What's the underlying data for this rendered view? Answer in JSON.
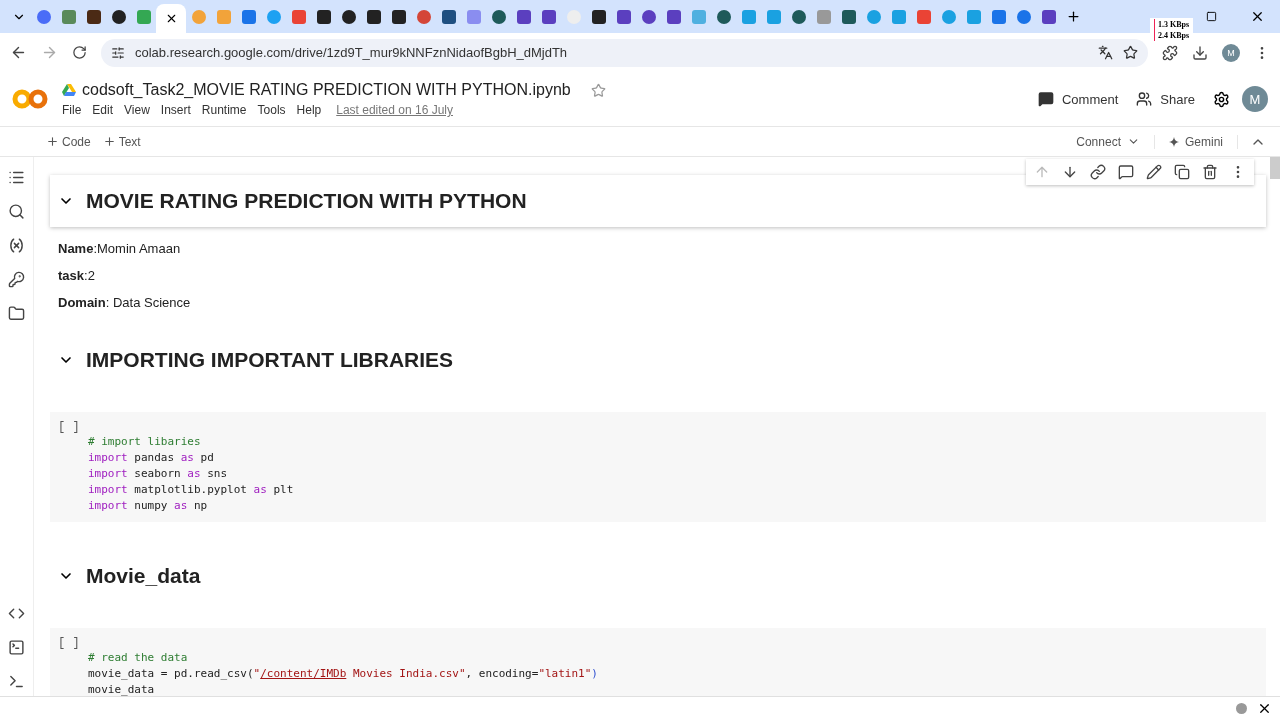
{
  "browser": {
    "url": "colab.research.google.com/drive/1zd9T_mur9kNNFznNidaofBgbH_dMjdTh",
    "net_speed": [
      "1.3 KBps",
      "2.4 KBps"
    ],
    "avatar": "M"
  },
  "notebook": {
    "title": "codsoft_Task2_MOVIE RATING PREDICTION WITH PYTHON.ipynb",
    "menu": [
      "File",
      "Edit",
      "View",
      "Insert",
      "Runtime",
      "Tools",
      "Help"
    ],
    "last_edited": "Last edited on 16 July",
    "comment": "Comment",
    "share": "Share",
    "avatar": "M"
  },
  "toolbar": {
    "add": [
      "Code",
      "Text"
    ],
    "connect": "Connect",
    "gemini": "Gemini"
  },
  "cells": [
    {
      "kind": "heading",
      "text": "MOVIE RATING PREDICTION WITH PYTHON",
      "expanded": true,
      "selected": true
    },
    {
      "kind": "markdown",
      "lines": [
        "**Name**:Momin Amaan",
        "**task**:2",
        "**Domain**: Data Science"
      ]
    },
    {
      "kind": "heading",
      "text": "IMPORTING IMPORTANT LIBRARIES",
      "expanded": true,
      "selected": false
    },
    {
      "kind": "code",
      "prompt": "[ ]",
      "selected": false,
      "lines": [
        [
          {
            "kind": "comment",
            "text": "# import libaries"
          }
        ],
        [
          {
            "kind": "keyword",
            "text": "import"
          },
          {
            "kind": "plain",
            "text": " pandas "
          },
          {
            "kind": "keyword",
            "text": "as"
          },
          {
            "kind": "plain",
            "text": " pd"
          }
        ],
        [
          {
            "kind": "keyword",
            "text": "import"
          },
          {
            "kind": "plain",
            "text": " seaborn "
          },
          {
            "kind": "keyword",
            "text": "as"
          },
          {
            "kind": "plain",
            "text": " sns"
          }
        ],
        [
          {
            "kind": "keyword",
            "text": "import"
          },
          {
            "kind": "plain",
            "text": " matplotlib.pyplot "
          },
          {
            "kind": "keyword",
            "text": "as"
          },
          {
            "kind": "plain",
            "text": " plt"
          }
        ],
        [
          {
            "kind": "keyword",
            "text": "import"
          },
          {
            "kind": "plain",
            "text": " numpy "
          },
          {
            "kind": "keyword",
            "text": "as"
          },
          {
            "kind": "plain",
            "text": " np"
          }
        ]
      ]
    },
    {
      "kind": "heading",
      "text": "Movie_data",
      "expanded": true,
      "selected": false
    },
    {
      "kind": "code",
      "prompt": "[ ]",
      "selected": false,
      "lines": [
        [
          {
            "kind": "comment",
            "text": "# read the data"
          }
        ],
        [
          {
            "kind": "plain",
            "text": "movie_data = pd.read_csv("
          },
          {
            "kind": "string",
            "text": "\""
          },
          {
            "kind": "path",
            "text": "/content/IMDb"
          },
          {
            "kind": "string",
            "text": " Movies India.csv\""
          },
          {
            "kind": "plain",
            "text": ", encoding="
          },
          {
            "kind": "string",
            "text": "\"latin1\""
          },
          {
            "kind": "paren",
            "text": ")"
          }
        ],
        [
          {
            "kind": "plain",
            "text": "movie_data"
          }
        ]
      ]
    }
  ]
}
